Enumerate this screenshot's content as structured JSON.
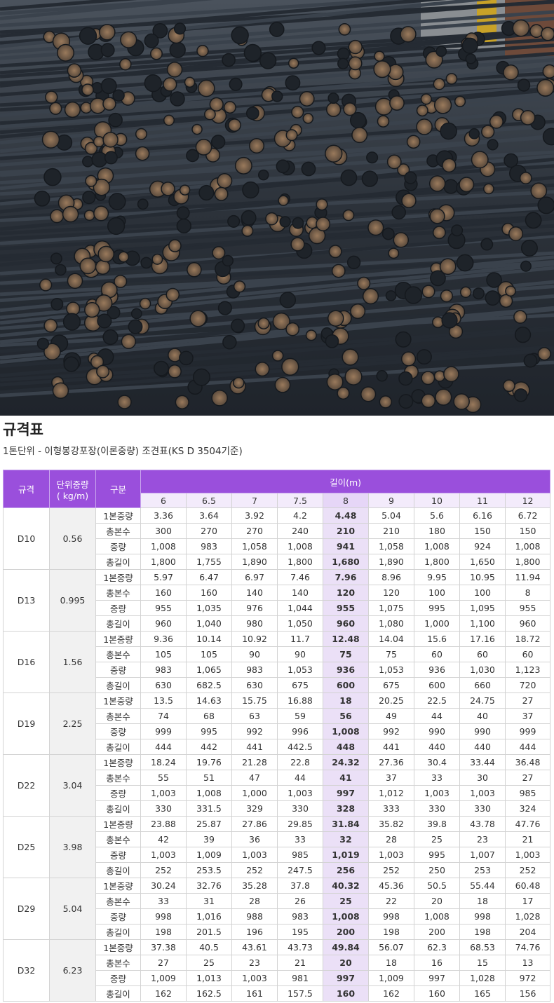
{
  "hero": {
    "alt": ""
  },
  "title": "규격표",
  "subtitle": "1톤단위 - 이형봉강포장(이론중량) 조견표(KS D 3504기준)",
  "table": {
    "headers": {
      "spec": "규격",
      "unit_weight_line1": "단위중량",
      "unit_weight_line2": "( kg/m)",
      "category": "구분",
      "length": "길이(m)"
    },
    "lengths": [
      "6",
      "6.5",
      "7",
      "7.5",
      "8",
      "9",
      "10",
      "11",
      "12"
    ],
    "highlight_length": "8",
    "categories": [
      "1본중량",
      "총본수",
      "중량",
      "총길이"
    ],
    "rows": [
      {
        "spec": "D10",
        "unit_weight": "0.56",
        "data": [
          [
            "3.36",
            "3.64",
            "3.92",
            "4.2",
            "4.48",
            "5.04",
            "5.6",
            "6.16",
            "6.72"
          ],
          [
            "300",
            "270",
            "270",
            "240",
            "210",
            "210",
            "180",
            "150",
            "150"
          ],
          [
            "1,008",
            "983",
            "1,058",
            "1,008",
            "941",
            "1,058",
            "1,008",
            "924",
            "1,008"
          ],
          [
            "1,800",
            "1,755",
            "1,890",
            "1,800",
            "1,680",
            "1,890",
            "1,800",
            "1,650",
            "1,800"
          ]
        ]
      },
      {
        "spec": "D13",
        "unit_weight": "0.995",
        "data": [
          [
            "5.97",
            "6.47",
            "6.97",
            "7.46",
            "7.96",
            "8.96",
            "9.95",
            "10.95",
            "11.94"
          ],
          [
            "160",
            "160",
            "140",
            "140",
            "120",
            "120",
            "100",
            "100",
            "8"
          ],
          [
            "955",
            "1,035",
            "976",
            "1,044",
            "955",
            "1,075",
            "995",
            "1,095",
            "955"
          ],
          [
            "960",
            "1,040",
            "980",
            "1,050",
            "960",
            "1,080",
            "1,000",
            "1,100",
            "960"
          ]
        ]
      },
      {
        "spec": "D16",
        "unit_weight": "1.56",
        "data": [
          [
            "9.36",
            "10.14",
            "10.92",
            "11.7",
            "12.48",
            "14.04",
            "15.6",
            "17.16",
            "18.72"
          ],
          [
            "105",
            "105",
            "90",
            "90",
            "75",
            "75",
            "60",
            "60",
            "60"
          ],
          [
            "983",
            "1,065",
            "983",
            "1,053",
            "936",
            "1,053",
            "936",
            "1,030",
            "1,123"
          ],
          [
            "630",
            "682.5",
            "630",
            "675",
            "600",
            "675",
            "600",
            "660",
            "720"
          ]
        ]
      },
      {
        "spec": "D19",
        "unit_weight": "2.25",
        "data": [
          [
            "13.5",
            "14.63",
            "15.75",
            "16.88",
            "18",
            "20.25",
            "22.5",
            "24.75",
            "27"
          ],
          [
            "74",
            "68",
            "63",
            "59",
            "56",
            "49",
            "44",
            "40",
            "37"
          ],
          [
            "999",
            "995",
            "992",
            "996",
            "1,008",
            "992",
            "990",
            "990",
            "999"
          ],
          [
            "444",
            "442",
            "441",
            "442.5",
            "448",
            "441",
            "440",
            "440",
            "444"
          ]
        ]
      },
      {
        "spec": "D22",
        "unit_weight": "3.04",
        "data": [
          [
            "18.24",
            "19.76",
            "21.28",
            "22.8",
            "24.32",
            "27.36",
            "30.4",
            "33.44",
            "36.48"
          ],
          [
            "55",
            "51",
            "47",
            "44",
            "41",
            "37",
            "33",
            "30",
            "27"
          ],
          [
            "1,003",
            "1,008",
            "1,000",
            "1,003",
            "997",
            "1,012",
            "1,003",
            "1,003",
            "985"
          ],
          [
            "330",
            "331.5",
            "329",
            "330",
            "328",
            "333",
            "330",
            "330",
            "324"
          ]
        ]
      },
      {
        "spec": "D25",
        "unit_weight": "3.98",
        "data": [
          [
            "23.88",
            "25.87",
            "27.86",
            "29.85",
            "31.84",
            "35.82",
            "39.8",
            "43.78",
            "47.76"
          ],
          [
            "42",
            "39",
            "36",
            "33",
            "32",
            "28",
            "25",
            "23",
            "21"
          ],
          [
            "1,003",
            "1,009",
            "1,003",
            "985",
            "1,019",
            "1,003",
            "995",
            "1,007",
            "1,003"
          ],
          [
            "252",
            "253.5",
            "252",
            "247.5",
            "256",
            "252",
            "250",
            "253",
            "252"
          ]
        ]
      },
      {
        "spec": "D29",
        "unit_weight": "5.04",
        "data": [
          [
            "30.24",
            "32.76",
            "35.28",
            "37.8",
            "40.32",
            "45.36",
            "50.5",
            "55.44",
            "60.48"
          ],
          [
            "33",
            "31",
            "28",
            "26",
            "25",
            "22",
            "20",
            "18",
            "17"
          ],
          [
            "998",
            "1,016",
            "988",
            "983",
            "1,008",
            "998",
            "1,008",
            "998",
            "1,028"
          ],
          [
            "198",
            "201.5",
            "196",
            "195",
            "200",
            "198",
            "200",
            "198",
            "204"
          ]
        ]
      },
      {
        "spec": "D32",
        "unit_weight": "6.23",
        "data": [
          [
            "37.38",
            "40.5",
            "43.61",
            "43.73",
            "49.84",
            "56.07",
            "62.3",
            "68.53",
            "74.76"
          ],
          [
            "27",
            "25",
            "23",
            "21",
            "20",
            "18",
            "16",
            "15",
            "13"
          ],
          [
            "1,009",
            "1,013",
            "1,003",
            "981",
            "997",
            "1,009",
            "997",
            "1,028",
            "972"
          ],
          [
            "162",
            "162.5",
            "161",
            "157.5",
            "160",
            "162",
            "160",
            "165",
            "156"
          ]
        ]
      }
    ]
  }
}
